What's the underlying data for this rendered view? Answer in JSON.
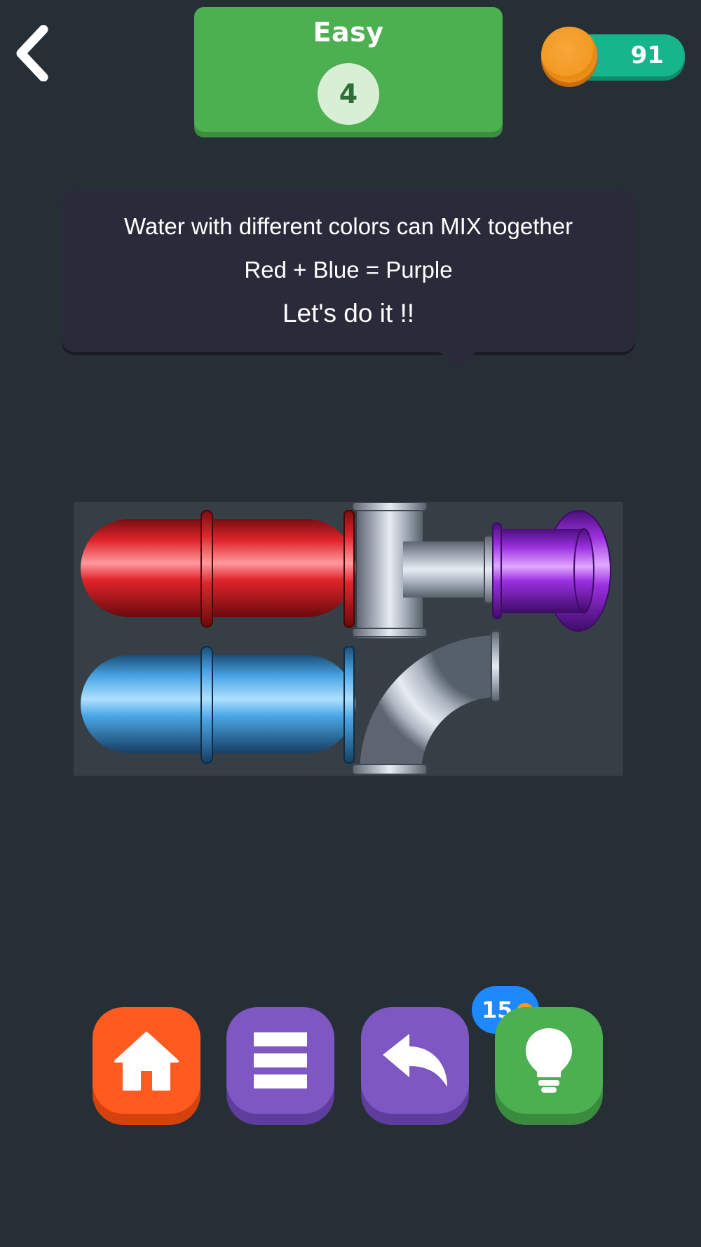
{
  "header": {
    "difficulty": "Easy",
    "level": "4",
    "coins": "91"
  },
  "tooltip": {
    "line1": "Water with different colors can MIX together",
    "line2": "Red + Blue = Purple",
    "line3": "Let's do it !!"
  },
  "board": {
    "pipes": [
      {
        "piece": "straight-pipe",
        "color_name": "red",
        "color": "#e0252b"
      },
      {
        "piece": "straight-pipe",
        "color_name": "blue",
        "color": "#4aa6e6"
      },
      {
        "piece": "tee-pipe",
        "color_name": "gray",
        "color": "#aeb7c2"
      },
      {
        "piece": "elbow-pipe",
        "color_name": "gray",
        "color": "#aeb7c2"
      },
      {
        "piece": "outlet-pipe",
        "color_name": "purple",
        "color": "#9b2fe0"
      }
    ]
  },
  "toolbar": {
    "hint_cost": "15",
    "buttons": [
      "home-icon",
      "menu-icon",
      "undo-icon",
      "lightbulb-icon"
    ]
  },
  "colors": {
    "background": "#262f36",
    "board": "#363f46",
    "level_card": "#4caf50",
    "coin_pill": "#16b58c",
    "home_button": "#ff5a1f",
    "purple_button": "#7e57c2",
    "hint_button": "#4caf50",
    "hint_cost_badge": "#1e88ff"
  }
}
